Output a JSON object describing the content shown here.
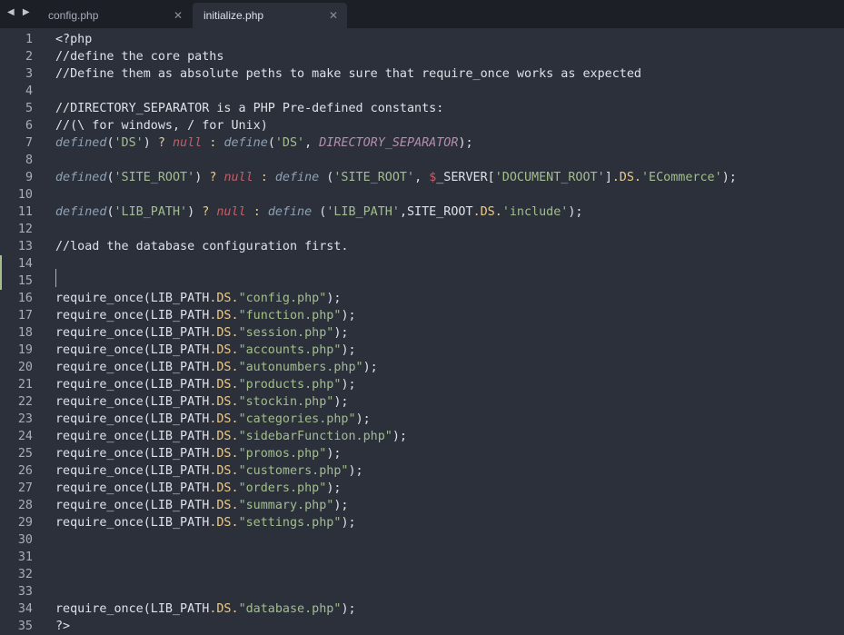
{
  "tabs": [
    {
      "label": "config.php",
      "active": false
    },
    {
      "label": "initialize.php",
      "active": true
    }
  ],
  "nav_arrows": "◀ ▶",
  "colors": {
    "background": "#2b303b",
    "tabbar": "#1c1f26",
    "comment": "#dfe1e8",
    "function": "#8fa1b3",
    "string": "#a3be8c",
    "keyword": "#bf616a",
    "operator": "#ebcb8b",
    "constant": "#b48ead",
    "caret": "#f0a04a",
    "modified_marker": "#a3be8c"
  },
  "editor": {
    "cursor_line": 15,
    "modified_lines": [
      14,
      15
    ],
    "lines": [
      {
        "n": "1",
        "t": [
          [
            "pl",
            "<?php"
          ]
        ]
      },
      {
        "n": "2",
        "t": [
          [
            "cm",
            "//define the core paths"
          ]
        ]
      },
      {
        "n": "3",
        "t": [
          [
            "cm",
            "//Define them as absolute peths to make sure that require_once works as expected"
          ]
        ]
      },
      {
        "n": "4",
        "t": []
      },
      {
        "n": "5",
        "t": [
          [
            "cm",
            "//DIRECTORY_SEPARATOR is a PHP Pre-defined constants:"
          ]
        ]
      },
      {
        "n": "6",
        "t": [
          [
            "cm",
            "//(\\ for windows, / for Unix)"
          ]
        ]
      },
      {
        "n": "7",
        "t": [
          [
            "fn",
            "defined"
          ],
          [
            "pl",
            "("
          ],
          [
            "st",
            "'DS'"
          ],
          [
            "pl",
            ") "
          ],
          [
            "op",
            "?"
          ],
          [
            "pl",
            " "
          ],
          [
            "nl",
            "null"
          ],
          [
            "pl",
            " "
          ],
          [
            "op",
            ":"
          ],
          [
            "pl",
            " "
          ],
          [
            "fn",
            "define"
          ],
          [
            "pl",
            "("
          ],
          [
            "st",
            "'DS'"
          ],
          [
            "pl",
            ", "
          ],
          [
            "cn",
            "DIRECTORY_SEPARATOR"
          ],
          [
            "pl",
            ");"
          ]
        ]
      },
      {
        "n": "8",
        "t": []
      },
      {
        "n": "9",
        "t": [
          [
            "fn",
            "defined"
          ],
          [
            "pl",
            "("
          ],
          [
            "st",
            "'SITE_ROOT'"
          ],
          [
            "pl",
            ") "
          ],
          [
            "op",
            "?"
          ],
          [
            "pl",
            " "
          ],
          [
            "nl",
            "null"
          ],
          [
            "pl",
            " "
          ],
          [
            "op",
            ":"
          ],
          [
            "pl",
            " "
          ],
          [
            "fn",
            "define"
          ],
          [
            "pl",
            " ("
          ],
          [
            "st",
            "'SITE_ROOT'"
          ],
          [
            "pl",
            ", "
          ],
          [
            "vr",
            "$"
          ],
          [
            "pl",
            "_SERVER["
          ],
          [
            "st",
            "'DOCUMENT_ROOT'"
          ],
          [
            "pl",
            "]"
          ],
          [
            "op",
            ".DS."
          ],
          [
            "st",
            "'ECommerce'"
          ],
          [
            "pl",
            ");"
          ]
        ]
      },
      {
        "n": "10",
        "t": []
      },
      {
        "n": "11",
        "t": [
          [
            "fn",
            "defined"
          ],
          [
            "pl",
            "("
          ],
          [
            "st",
            "'LIB_PATH'"
          ],
          [
            "pl",
            ") "
          ],
          [
            "op",
            "?"
          ],
          [
            "pl",
            " "
          ],
          [
            "nl",
            "null"
          ],
          [
            "pl",
            " "
          ],
          [
            "op",
            ":"
          ],
          [
            "pl",
            " "
          ],
          [
            "fn",
            "define"
          ],
          [
            "pl",
            " ("
          ],
          [
            "st",
            "'LIB_PATH'"
          ],
          [
            "pl",
            ",SITE_ROOT"
          ],
          [
            "op",
            ".DS."
          ],
          [
            "st",
            "'include'"
          ],
          [
            "pl",
            ");"
          ]
        ]
      },
      {
        "n": "12",
        "t": []
      },
      {
        "n": "13",
        "t": [
          [
            "cm",
            "//load the database configuration first."
          ]
        ]
      },
      {
        "n": "14",
        "t": []
      },
      {
        "n": "15",
        "t": []
      },
      {
        "n": "16",
        "t": [
          [
            "pl",
            "require_once(LIB_PATH"
          ],
          [
            "op",
            ".DS."
          ],
          [
            "st",
            "\"config.php\""
          ],
          [
            "pl",
            ");"
          ]
        ]
      },
      {
        "n": "17",
        "t": [
          [
            "pl",
            "require_once(LIB_PATH"
          ],
          [
            "op",
            ".DS."
          ],
          [
            "st",
            "\"function.php\""
          ],
          [
            "pl",
            ");"
          ]
        ]
      },
      {
        "n": "18",
        "t": [
          [
            "pl",
            "require_once(LIB_PATH"
          ],
          [
            "op",
            ".DS."
          ],
          [
            "st",
            "\"session.php\""
          ],
          [
            "pl",
            ");"
          ]
        ]
      },
      {
        "n": "19",
        "t": [
          [
            "pl",
            "require_once(LIB_PATH"
          ],
          [
            "op",
            ".DS."
          ],
          [
            "st",
            "\"accounts.php\""
          ],
          [
            "pl",
            ");"
          ]
        ]
      },
      {
        "n": "20",
        "t": [
          [
            "pl",
            "require_once(LIB_PATH"
          ],
          [
            "op",
            ".DS."
          ],
          [
            "st",
            "\"autonumbers.php\""
          ],
          [
            "pl",
            ");"
          ]
        ]
      },
      {
        "n": "21",
        "t": [
          [
            "pl",
            "require_once(LIB_PATH"
          ],
          [
            "op",
            ".DS."
          ],
          [
            "st",
            "\"products.php\""
          ],
          [
            "pl",
            ");"
          ]
        ]
      },
      {
        "n": "22",
        "t": [
          [
            "pl",
            "require_once(LIB_PATH"
          ],
          [
            "op",
            ".DS."
          ],
          [
            "st",
            "\"stockin.php\""
          ],
          [
            "pl",
            ");"
          ]
        ]
      },
      {
        "n": "23",
        "t": [
          [
            "pl",
            "require_once(LIB_PATH"
          ],
          [
            "op",
            ".DS."
          ],
          [
            "st",
            "\"categories.php\""
          ],
          [
            "pl",
            ");"
          ]
        ]
      },
      {
        "n": "24",
        "t": [
          [
            "pl",
            "require_once(LIB_PATH"
          ],
          [
            "op",
            ".DS."
          ],
          [
            "st",
            "\"sidebarFunction.php\""
          ],
          [
            "pl",
            ");"
          ]
        ]
      },
      {
        "n": "25",
        "t": [
          [
            "pl",
            "require_once(LIB_PATH"
          ],
          [
            "op",
            ".DS."
          ],
          [
            "st",
            "\"promos.php\""
          ],
          [
            "pl",
            ");"
          ]
        ]
      },
      {
        "n": "26",
        "t": [
          [
            "pl",
            "require_once(LIB_PATH"
          ],
          [
            "op",
            ".DS."
          ],
          [
            "st",
            "\"customers.php\""
          ],
          [
            "pl",
            ");"
          ]
        ]
      },
      {
        "n": "27",
        "t": [
          [
            "pl",
            "require_once(LIB_PATH"
          ],
          [
            "op",
            ".DS."
          ],
          [
            "st",
            "\"orders.php\""
          ],
          [
            "pl",
            ");"
          ]
        ]
      },
      {
        "n": "28",
        "t": [
          [
            "pl",
            "require_once(LIB_PATH"
          ],
          [
            "op",
            ".DS."
          ],
          [
            "st",
            "\"summary.php\""
          ],
          [
            "pl",
            ");"
          ]
        ]
      },
      {
        "n": "29",
        "t": [
          [
            "pl",
            "require_once(LIB_PATH"
          ],
          [
            "op",
            ".DS."
          ],
          [
            "st",
            "\"settings.php\""
          ],
          [
            "pl",
            ");"
          ]
        ]
      },
      {
        "n": "30",
        "t": []
      },
      {
        "n": "31",
        "t": []
      },
      {
        "n": "32",
        "t": []
      },
      {
        "n": "33",
        "t": []
      },
      {
        "n": "34",
        "t": [
          [
            "pl",
            "require_once(LIB_PATH"
          ],
          [
            "op",
            ".DS."
          ],
          [
            "st",
            "\"database.php\""
          ],
          [
            "pl",
            ");"
          ]
        ]
      },
      {
        "n": "35",
        "t": [
          [
            "pl",
            "?>"
          ]
        ]
      }
    ]
  }
}
